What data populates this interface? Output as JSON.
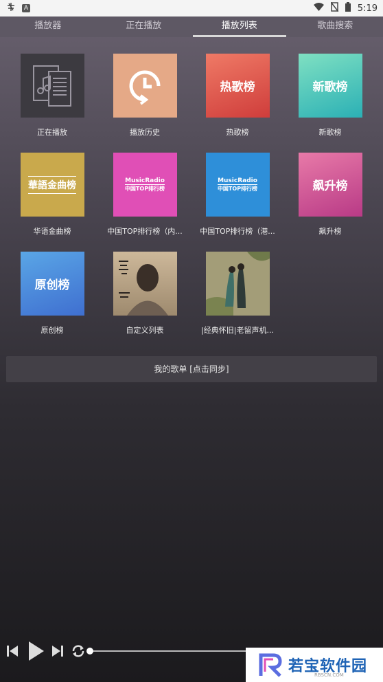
{
  "statusbar": {
    "time": "5:19",
    "app_icon": "bug-icon",
    "badge": "A"
  },
  "tabs": [
    {
      "label": "播放器",
      "active": false
    },
    {
      "label": "正在播放",
      "active": false
    },
    {
      "label": "播放列表",
      "active": true
    },
    {
      "label": "歌曲搜索",
      "active": false
    }
  ],
  "tiles": [
    {
      "label": "正在播放",
      "cover": "",
      "cover_bg": "#3c3a40"
    },
    {
      "label": "播放历史",
      "cover": "",
      "cover_bg": "#e5a987"
    },
    {
      "label": "热歌榜",
      "cover": "热歌榜",
      "cover_bg": "#d9554f"
    },
    {
      "label": "新歌榜",
      "cover": "新歌榜",
      "cover_bg": "#3fc0b0"
    },
    {
      "label": "华语金曲榜",
      "cover": "華語金曲榜",
      "cover_bg": "#c9a94c"
    },
    {
      "label": "中国TOP排行榜（内...",
      "cover_brand": "MusicRadio",
      "cover_brand2": "中国TOP排行榜",
      "cover_bg": "#e04fb6"
    },
    {
      "label": "中国TOP排行榜（港...",
      "cover_brand": "MusicRadio",
      "cover_brand2": "中国TOP排行榜",
      "cover_bg": "#2e8fd9"
    },
    {
      "label": "飙升榜",
      "cover": "飙升榜",
      "cover_bg": "#c44a8e"
    },
    {
      "label": "原创榜",
      "cover": "原创榜",
      "cover_bg": "#4a83d6"
    },
    {
      "label": "自定义列表",
      "cover": "",
      "cover_bg": "#b8a284"
    },
    {
      "label": "|经典怀旧|老留声机...",
      "cover": "",
      "cover_bg": "#8f8a66"
    }
  ],
  "mylist": "我的歌单 [点击同步]",
  "watermark": {
    "text": "若宝软件园",
    "sub": "RBSCN.COM"
  }
}
